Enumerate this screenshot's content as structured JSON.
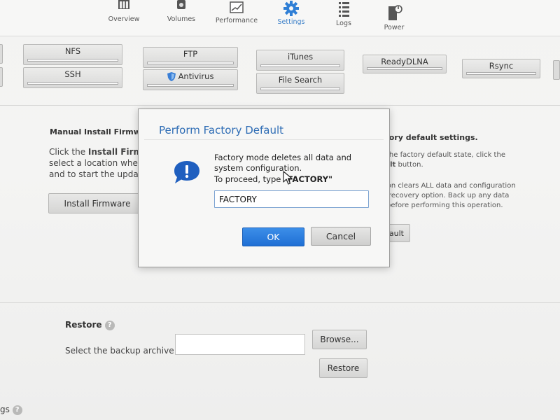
{
  "nav": {
    "items": [
      {
        "id": "overview",
        "label": "Overview",
        "icon": "overview-icon"
      },
      {
        "id": "volumes",
        "label": "Volumes",
        "icon": "volumes-icon"
      },
      {
        "id": "performance",
        "label": "Performance",
        "icon": "performance-icon"
      },
      {
        "id": "settings",
        "label": "Settings",
        "icon": "gear-icon",
        "active": true
      },
      {
        "id": "logs",
        "label": "Logs",
        "icon": "logs-icon"
      },
      {
        "id": "power",
        "label": "Power",
        "icon": "power-icon"
      }
    ]
  },
  "services": {
    "nfs": "NFS",
    "ftp": "FTP",
    "itunes": "iTunes",
    "readydlna": "ReadyDLNA",
    "rsync": "Rsync",
    "ssh": "SSH",
    "antivirus": "Antivirus",
    "file_search": "File Search"
  },
  "firmware": {
    "title": "Manual Install Firmwa",
    "line1_pre": "Click the ",
    "line1_bold": "Install Firmwa",
    "line2": "select a location where",
    "line3": "and to start the update",
    "button": "Install Firmware"
  },
  "factory_bg": {
    "title": "ctory default settings.",
    "line1": "the factory default state, click the",
    "line2_bold": "ult",
    "line2_rest": " button.",
    "line3": "ion clears ALL data and configuration",
    "line4": "recovery option. Back up any data",
    "line5": "before performing this operation.",
    "button": "fault"
  },
  "restore": {
    "title": "Restore",
    "label": "Select the backup archive:",
    "browse_button": "Browse...",
    "restore_button": "Restore",
    "input_value": ""
  },
  "footer": {
    "text": "gs"
  },
  "modal": {
    "title": "Perform Factory Default",
    "message": "Factory mode deletes all data and system configuration.",
    "prompt_text": "To proceed, type ",
    "prompt_keyword": "\"FACTORY\"",
    "input_value": "FACTORY",
    "ok_label": "OK",
    "cancel_label": "Cancel"
  },
  "colors": {
    "accent": "#2f6db5",
    "ok_button": "#2a7fe0",
    "info_icon": "#1f5fbf"
  }
}
